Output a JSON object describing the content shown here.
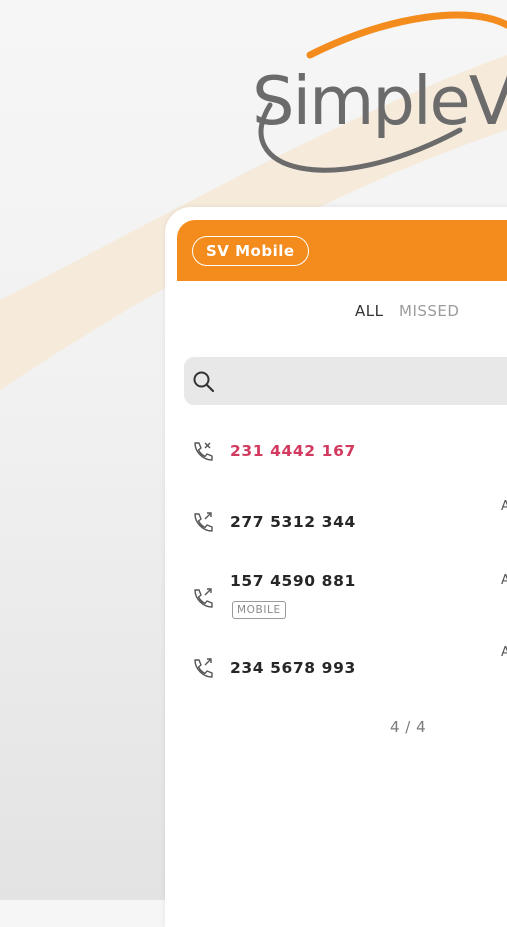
{
  "logo": {
    "text": "SimpleVoIP"
  },
  "header": {
    "brand_label": "SV Mobile"
  },
  "tabs": [
    {
      "label": "ALL",
      "active": true
    },
    {
      "label": "MISSED",
      "active": false
    }
  ],
  "search": {
    "placeholder": ""
  },
  "calls": [
    {
      "number": "231 4442 167",
      "type": "missed",
      "icon": "phone-missed-icon",
      "tag": "",
      "time_clipped": ""
    },
    {
      "number": "277 5312 344",
      "type": "outgoing",
      "icon": "phone-outgoing-icon",
      "tag": "",
      "time_clipped": "A"
    },
    {
      "number": "157 4590 881",
      "type": "outgoing",
      "icon": "phone-outgoing-icon",
      "tag": "MOBILE",
      "time_clipped": "A"
    },
    {
      "number": "234 5678 993",
      "type": "outgoing",
      "icon": "phone-outgoing-icon",
      "tag": "",
      "time_clipped": "A"
    }
  ],
  "pager": {
    "text": "4 / 4"
  },
  "colors": {
    "accent": "#f48b1d",
    "missed": "#d23a5f",
    "logo_gray": "#6b6b6b"
  }
}
